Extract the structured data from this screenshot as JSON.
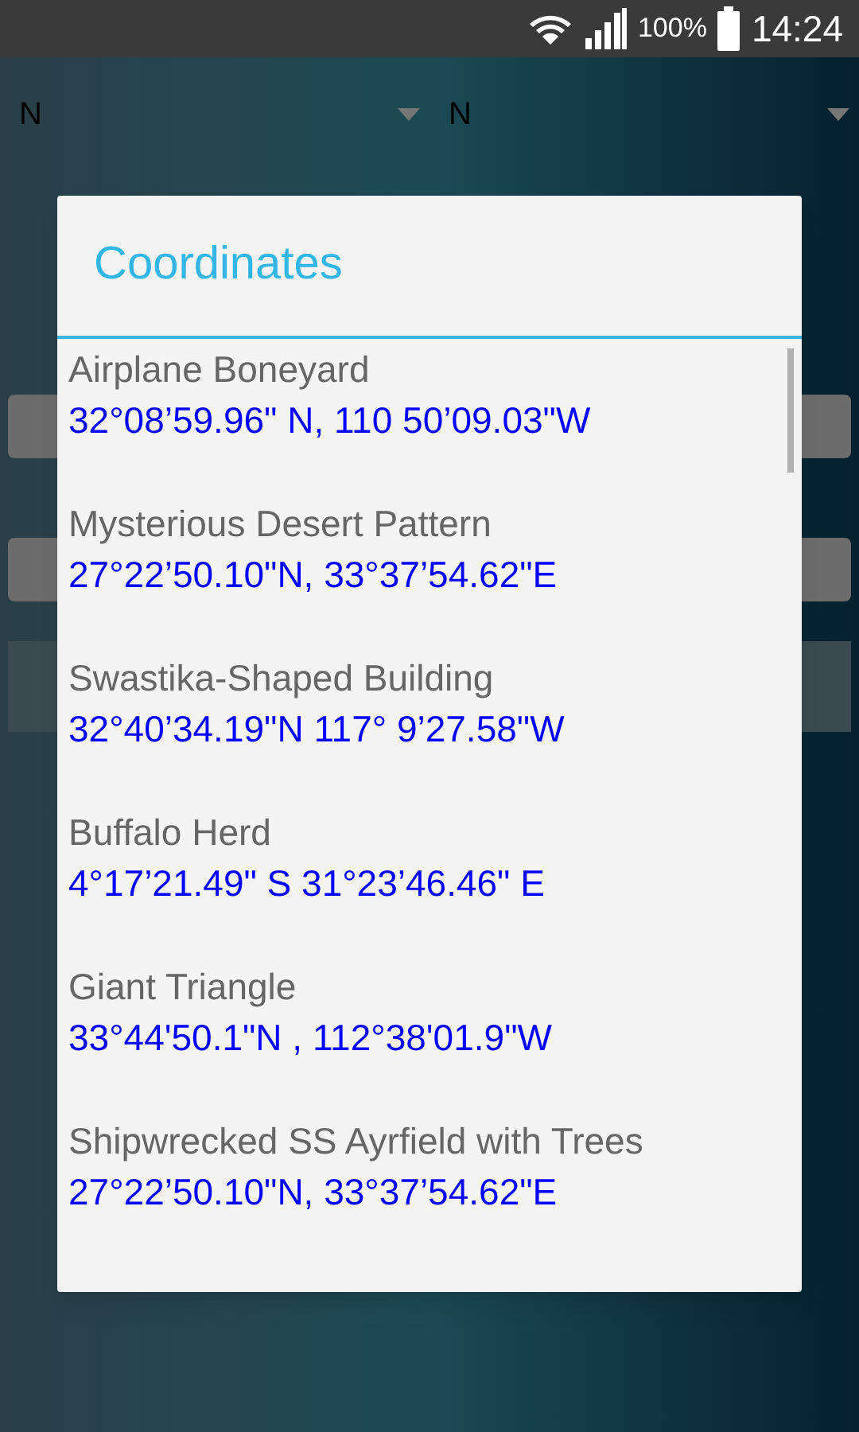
{
  "status_bar": {
    "battery": "100%",
    "time": "14:24"
  },
  "spinners": [
    {
      "value": "N"
    },
    {
      "value": "N"
    }
  ],
  "dialog": {
    "title": "Coordinates",
    "items": [
      {
        "name": "Airplane Boneyard",
        "coordinates": "32°08’59.96\" N, 110 50’09.03\"W"
      },
      {
        "name": "Mysterious Desert Pattern",
        "coordinates": "27°22’50.10\"N, 33°37’54.62\"E"
      },
      {
        "name": "Swastika-Shaped Building",
        "coordinates": "32°40’34.19\"N 117° 9’27.58\"W"
      },
      {
        "name": "Buffalo Herd",
        "coordinates": "4°17’21.49\" S 31°23’46.46\" E"
      },
      {
        "name": "Giant Triangle",
        "coordinates": "33°44'50.1\"N , 112°38'01.9\"W"
      },
      {
        "name": "Shipwrecked SS Ayrfield with Trees",
        "coordinates": "27°22’50.10\"N, 33°37’54.62\"E"
      }
    ]
  }
}
